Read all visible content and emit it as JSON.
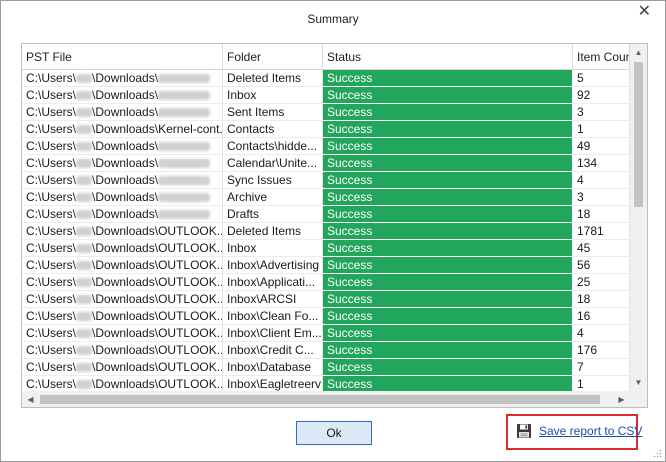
{
  "window": {
    "title": "Summary",
    "close_glyph": "✕"
  },
  "table": {
    "columns": [
      "PST File",
      "Folder",
      "Status",
      "Item Count"
    ],
    "rows": [
      {
        "path_a": "C:\\Users\\",
        "path_b": "\\Downloads\\",
        "path_c": "",
        "folder": "Deleted Items",
        "status": "Success",
        "count": "5"
      },
      {
        "path_a": "C:\\Users\\",
        "path_b": "\\Downloads\\",
        "path_c": "",
        "folder": "Inbox",
        "status": "Success",
        "count": "92"
      },
      {
        "path_a": "C:\\Users\\",
        "path_b": "\\Downloads\\",
        "path_c": "",
        "folder": "Sent Items",
        "status": "Success",
        "count": "3"
      },
      {
        "path_a": "C:\\Users\\",
        "path_b": "\\Downloads\\",
        "path_c": "Kernel-cont...",
        "folder": "Contacts",
        "status": "Success",
        "count": "1"
      },
      {
        "path_a": "C:\\Users\\",
        "path_b": "\\Downloads\\",
        "path_c": "",
        "folder": "Contacts\\hidde...",
        "status": "Success",
        "count": "49"
      },
      {
        "path_a": "C:\\Users\\",
        "path_b": "\\Downloads\\",
        "path_c": "",
        "folder": "Calendar\\Unite...",
        "status": "Success",
        "count": "134"
      },
      {
        "path_a": "C:\\Users\\",
        "path_b": "\\Downloads\\",
        "path_c": "",
        "folder": "Sync Issues",
        "status": "Success",
        "count": "4"
      },
      {
        "path_a": "C:\\Users\\",
        "path_b": "\\Downloads\\",
        "path_c": "",
        "folder": "Archive",
        "status": "Success",
        "count": "3"
      },
      {
        "path_a": "C:\\Users\\",
        "path_b": "\\Downloads\\",
        "path_c": "",
        "folder": "Drafts",
        "status": "Success",
        "count": "18"
      },
      {
        "path_a": "C:\\Users\\",
        "path_b": "\\Downloads\\",
        "path_c": "OUTLOOK....",
        "folder": "Deleted Items",
        "status": "Success",
        "count": "1781"
      },
      {
        "path_a": "C:\\Users\\",
        "path_b": "\\Downloads\\",
        "path_c": "OUTLOOK....",
        "folder": "Inbox",
        "status": "Success",
        "count": "45"
      },
      {
        "path_a": "C:\\Users\\",
        "path_b": "\\Downloads\\",
        "path_c": "OUTLOOK....",
        "folder": "Inbox\\Advertising",
        "status": "Success",
        "count": "56"
      },
      {
        "path_a": "C:\\Users\\",
        "path_b": "\\Downloads\\",
        "path_c": "OUTLOOK....",
        "folder": "Inbox\\Applicati...",
        "status": "Success",
        "count": "25"
      },
      {
        "path_a": "C:\\Users\\",
        "path_b": "\\Downloads\\",
        "path_c": "OUTLOOK....",
        "folder": "Inbox\\ARCSI",
        "status": "Success",
        "count": "18"
      },
      {
        "path_a": "C:\\Users\\",
        "path_b": "\\Downloads\\",
        "path_c": "OUTLOOK....",
        "folder": "Inbox\\Clean Fo...",
        "status": "Success",
        "count": "16"
      },
      {
        "path_a": "C:\\Users\\",
        "path_b": "\\Downloads\\",
        "path_c": "OUTLOOK....",
        "folder": "Inbox\\Client Em...",
        "status": "Success",
        "count": "4"
      },
      {
        "path_a": "C:\\Users\\",
        "path_b": "\\Downloads\\",
        "path_c": "OUTLOOK....",
        "folder": "Inbox\\Credit C...",
        "status": "Success",
        "count": "176"
      },
      {
        "path_a": "C:\\Users\\",
        "path_b": "\\Downloads\\",
        "path_c": "OUTLOOK....",
        "folder": "Inbox\\Database",
        "status": "Success",
        "count": "7"
      },
      {
        "path_a": "C:\\Users\\",
        "path_b": "\\Downloads\\",
        "path_c": "OUTLOOK....",
        "folder": "Inbox\\Eagletreerv",
        "status": "Success",
        "count": "1"
      }
    ]
  },
  "buttons": {
    "ok_label": "Ok",
    "save_report_label": "Save report to CSV"
  },
  "icons": {
    "close": "close-icon",
    "scroll_up": "chevron-up-icon",
    "scroll_down": "chevron-down-icon",
    "scroll_left": "chevron-left-icon",
    "scroll_right": "chevron-right-icon",
    "save": "floppy-disk-icon",
    "resize": "resize-grip-icon"
  },
  "colors": {
    "status_success": "#21a65b",
    "highlight_border": "#d62d2d",
    "link": "#1a4fb0",
    "ok_border": "#2a6fbf",
    "ok_fill": "#dce9f7"
  }
}
